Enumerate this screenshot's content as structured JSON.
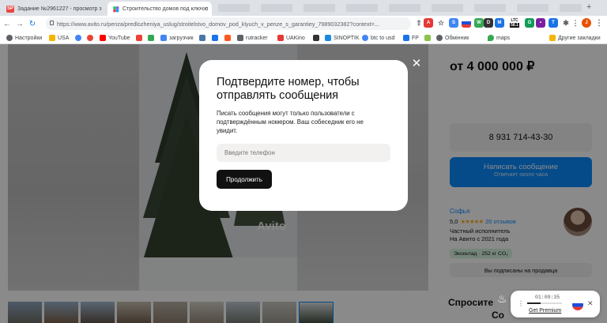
{
  "browser": {
    "tabs": [
      {
        "title": "Задание №2961227 - просмотр з",
        "favicon_text": "SP",
        "favicon_color": "#e8473f",
        "active": false
      },
      {
        "title": "Строительство домов под ключ п",
        "favicon_color": "#34a853",
        "active": true
      }
    ],
    "url": "https://www.avito.ru/penza/predlozheniya_uslug/stroitelstvo_domov_pod_klyuch_v_penze_s_garantiey_7989032382?context=...",
    "extensions": {
      "ltc_label": "LTC",
      "ltc_value": "58.1"
    }
  },
  "bookmarks": [
    {
      "label": "Настройки",
      "icon_color": "#5f6368"
    },
    {
      "label": "USA",
      "icon_color": "#f4b400"
    },
    {
      "label": "",
      "icon_color": "#4285f4"
    },
    {
      "label": "",
      "icon_color": "#ea4335"
    },
    {
      "label": "YouTube",
      "icon_color": "#ff0000"
    },
    {
      "label": "",
      "icon_color": "#ea4335"
    },
    {
      "label": "",
      "icon_color": "#34a853"
    },
    {
      "label": "загрузчик",
      "icon_color": "#4285f4"
    },
    {
      "label": "",
      "icon_color": "#4a76a8"
    },
    {
      "label": "",
      "icon_color": "#1a73e8"
    },
    {
      "label": "",
      "icon_color": "#ff5722"
    },
    {
      "label": "rutracker",
      "icon_color": "#5f6368"
    },
    {
      "label": "UAKino",
      "icon_color": "#e53935"
    },
    {
      "label": "",
      "icon_color": "#333333"
    },
    {
      "label": "SINOPTIK",
      "icon_color": "#1e88e5"
    },
    {
      "label": "btc to usd",
      "icon_color": "#4285f4"
    },
    {
      "label": "FP",
      "icon_color": "#1a73e8"
    },
    {
      "label": "",
      "icon_color": "#8bc34a"
    },
    {
      "label": "Обмінник",
      "icon_color": "#5f6368"
    },
    {
      "label": "maps",
      "icon_color": "#34a853"
    },
    {
      "label": "Другие закладки",
      "icon_color": "#f4b400"
    }
  ],
  "listing": {
    "price": "от 4 000 000 ₽",
    "phone": "8 931 714-43-30",
    "message_button": "Написать сообщение",
    "message_sub": "Отвечает около часа",
    "seller_name": "Софья",
    "rating": "5,0",
    "stars": "★★★★★",
    "reviews": "20 отзывов",
    "seller_type": "Частный исполнитель",
    "since": "На Авито с 2021 года",
    "eco": "Экокклад · 252 кг CO₂",
    "subscribed": "Вы подписаны на продавца",
    "similar": "Спросите",
    "similar2": "Со",
    "watermark": "Avito",
    "accent": "#0a8bff"
  },
  "modal": {
    "title": "Подтвердите номер, чтобы отправлять сообщения",
    "body": "Писать сообщения могут только пользователи с подтверждённым номером. Ваш собеседник его не увидит.",
    "phone_placeholder": "Введите телефон",
    "continue_label": "Продолжить",
    "close_icon": "close-icon"
  },
  "vpn_widget": {
    "time": "01:09:35",
    "progress": 0.38,
    "premium_label": "Get Premium"
  }
}
